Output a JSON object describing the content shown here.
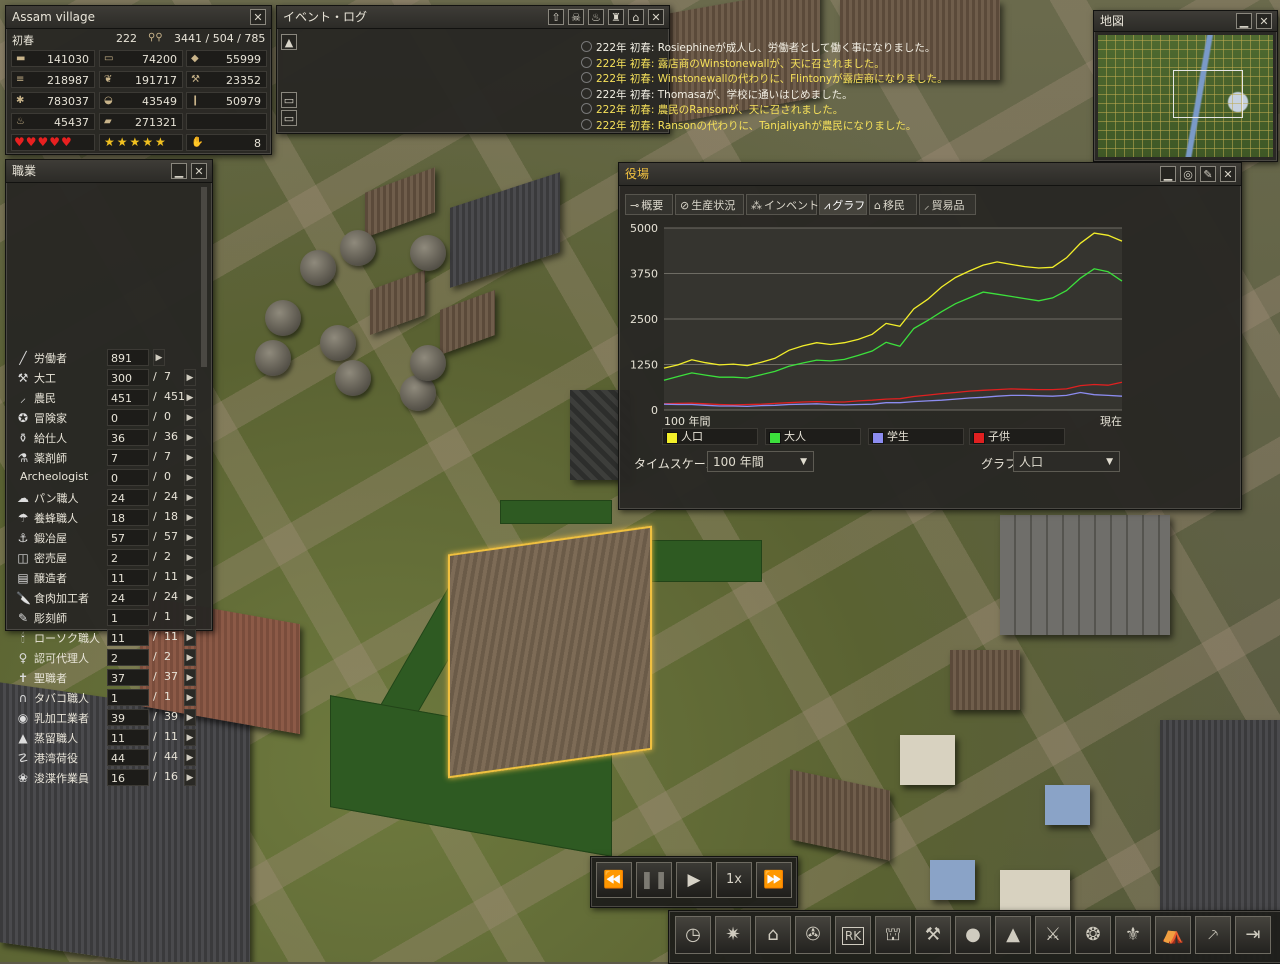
{
  "town": {
    "name": "Assam village",
    "season": "初春",
    "year": "222",
    "population": "3441 / 504 / 785",
    "resources": [
      [
        "141030",
        "74200",
        "55999"
      ],
      [
        "218987",
        "191717",
        "23352"
      ],
      [
        "783037",
        "43549",
        "50979"
      ],
      [
        "45437",
        "271321",
        ""
      ]
    ],
    "health_hearts": 5,
    "happiness_stars": 5,
    "alert_count": "8"
  },
  "eventlog": {
    "title": "イベント・ログ",
    "entries": [
      {
        "text": "222年 初春: Rosiephineが成人し、労働者として働く事になりました。",
        "color": "#f2efe4"
      },
      {
        "text": "222年 初春: 露店商のWinstonewallが、天に召されました。",
        "color": "#f5e05a"
      },
      {
        "text": "222年 初春: Winstonewallの代わりに、Flintonyが露店商になりました。",
        "color": "#f5e05a"
      },
      {
        "text": "222年 初春: Thomasaが、学校に通いはじめました。",
        "color": "#f2efe4"
      },
      {
        "text": "222年 初春: 農民のRansonが、天に召されました。",
        "color": "#f5e05a"
      },
      {
        "text": "222年 初春: Ransonの代わりに、Tanjaliyahが農民になりました。",
        "color": "#f5e05a"
      }
    ]
  },
  "minimap": {
    "title": "地図"
  },
  "jobs": {
    "title": "職業",
    "rows": [
      {
        "icon": "╱",
        "name": "労働者",
        "count": "891",
        "max": ""
      },
      {
        "icon": "⚒",
        "name": "大工",
        "count": "300",
        "max": "7"
      },
      {
        "icon": "⸝",
        "name": "農民",
        "count": "451",
        "max": "451"
      },
      {
        "icon": "✪",
        "name": "冒険家",
        "count": "0",
        "max": "0"
      },
      {
        "icon": "⚱",
        "name": "給仕人",
        "count": "36",
        "max": "36"
      },
      {
        "icon": "⚗",
        "name": "薬剤師",
        "count": "7",
        "max": "7"
      },
      {
        "icon": "",
        "name": "Archeologist",
        "count": "0",
        "max": "0"
      },
      {
        "icon": "☁",
        "name": "パン職人",
        "count": "24",
        "max": "24"
      },
      {
        "icon": "☂",
        "name": "養蜂職人",
        "count": "18",
        "max": "18"
      },
      {
        "icon": "⚓",
        "name": "鍛冶屋",
        "count": "57",
        "max": "57"
      },
      {
        "icon": "◫",
        "name": "密売屋",
        "count": "2",
        "max": "2"
      },
      {
        "icon": "▤",
        "name": "醸造者",
        "count": "11",
        "max": "11"
      },
      {
        "icon": "🔪",
        "name": "食肉加工者",
        "count": "24",
        "max": "24"
      },
      {
        "icon": "✎",
        "name": "彫刻師",
        "count": "1",
        "max": "1"
      },
      {
        "icon": "🕯",
        "name": "ローソク職人",
        "count": "11",
        "max": "11"
      },
      {
        "icon": "♀",
        "name": "認可代理人",
        "count": "2",
        "max": "2"
      },
      {
        "icon": "✝",
        "name": "聖職者",
        "count": "37",
        "max": "37"
      },
      {
        "icon": "∩",
        "name": "タバコ職人",
        "count": "1",
        "max": "1"
      },
      {
        "icon": "◉",
        "name": "乳加工業者",
        "count": "39",
        "max": "39"
      },
      {
        "icon": "▲",
        "name": "蒸留職人",
        "count": "11",
        "max": "11"
      },
      {
        "icon": "☡",
        "name": "港湾荷役",
        "count": "44",
        "max": "44"
      },
      {
        "icon": "❀",
        "name": "浚渫作業員",
        "count": "16",
        "max": "16"
      }
    ]
  },
  "townhall": {
    "title": "役場",
    "tabs": [
      {
        "icon": "⊸",
        "label": "概要"
      },
      {
        "icon": "⊘",
        "label": "生産状況"
      },
      {
        "icon": "⁂",
        "label": "インベントリ"
      },
      {
        "icon": "⩘",
        "label": "グラフ"
      },
      {
        "icon": "⌂",
        "label": "移民"
      },
      {
        "icon": "⸝",
        "label": "貿易品"
      }
    ],
    "timescale_label": "タイムスケール",
    "timescale_value": "100 年間",
    "graph_label": "グラフ",
    "graph_value": "人口"
  },
  "chart_data": {
    "type": "line",
    "title": "",
    "ylim": [
      0,
      5000
    ],
    "yticks": [
      "5000",
      "3750",
      "2500",
      "1250",
      "0"
    ],
    "x_start_label": "100 年間",
    "x_end_label": "現在",
    "series": [
      {
        "name": "人口",
        "color": "#f2ee2a",
        "values": [
          1150,
          1240,
          1380,
          1300,
          1240,
          1260,
          1220,
          1310,
          1420,
          1640,
          1760,
          1850,
          1800,
          1850,
          1940,
          2080,
          2380,
          2300,
          2780,
          3040,
          3380,
          3640,
          3820,
          3980,
          4070,
          4000,
          3940,
          3900,
          3920,
          4180,
          4580,
          4860,
          4800,
          4640
        ]
      },
      {
        "name": "大人",
        "color": "#3ce03c",
        "values": [
          820,
          920,
          1020,
          960,
          900,
          900,
          880,
          970,
          1060,
          1200,
          1290,
          1370,
          1350,
          1390,
          1500,
          1620,
          1860,
          1750,
          2240,
          2460,
          2700,
          2920,
          3080,
          3240,
          3180,
          3120,
          3060,
          3000,
          3080,
          3280,
          3620,
          3880,
          3800,
          3540
        ]
      },
      {
        "name": "学生",
        "color": "#8c8cf0",
        "values": [
          160,
          150,
          150,
          130,
          110,
          110,
          100,
          120,
          130,
          150,
          160,
          170,
          150,
          140,
          150,
          160,
          200,
          200,
          230,
          250,
          270,
          300,
          330,
          350,
          380,
          400,
          400,
          390,
          380,
          400,
          480,
          420,
          400,
          380
        ]
      },
      {
        "name": "子供",
        "color": "#e02020",
        "values": [
          170,
          180,
          190,
          170,
          150,
          140,
          150,
          160,
          180,
          200,
          220,
          230,
          220,
          220,
          250,
          270,
          300,
          310,
          370,
          410,
          450,
          480,
          520,
          540,
          560,
          580,
          570,
          560,
          560,
          580,
          670,
          700,
          680,
          760
        ]
      }
    ]
  },
  "speed": {
    "label": "1x"
  },
  "toolbar": {
    "icons": [
      "clock-icon",
      "gear-icon",
      "house-icon",
      "wheel-icon",
      "rk-icon",
      "barn-icon",
      "hammer-icon",
      "apple-icon",
      "tree-icon",
      "tools-icon",
      "stone-icon",
      "fleur-icon",
      "market-icon",
      "axe-icon",
      "exit-icon"
    ],
    "rk_text": "RK"
  }
}
